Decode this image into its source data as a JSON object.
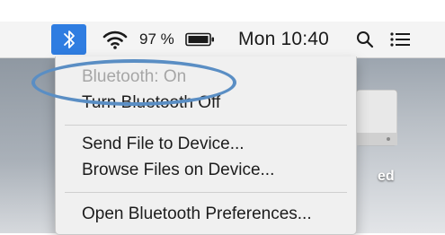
{
  "menubar": {
    "bluetooth_icon": "bluetooth-icon",
    "wifi_icon": "wifi-icon",
    "battery_percent": "97 %",
    "battery_icon": "battery-icon",
    "clock": "Mon 10:40",
    "spotlight_icon": "search-icon",
    "notification_icon": "list-icon"
  },
  "menu": {
    "status": "Bluetooth: On",
    "items": [
      {
        "label": "Turn Bluetooth Off"
      },
      {
        "label": "Send File to Device..."
      },
      {
        "label": "Browse Files on Device..."
      },
      {
        "label": "Open Bluetooth Preferences..."
      }
    ]
  },
  "desktop": {
    "drive_label": "ed"
  },
  "colors": {
    "bluetooth_active_bg": "#2f7de1",
    "annotation_oval": "#5a8ec4",
    "menu_bg": "#f0f0f0",
    "disabled_text": "#a6a6a6"
  }
}
